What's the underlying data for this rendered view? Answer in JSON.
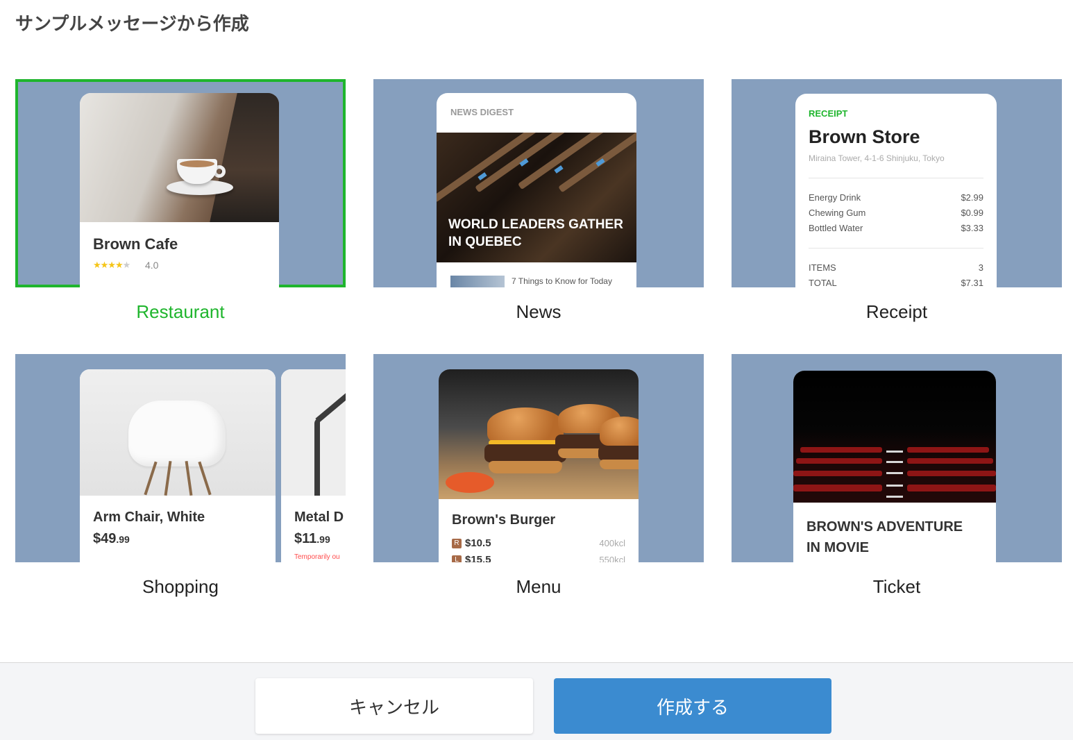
{
  "title": "サンプルメッセージから作成",
  "templates": {
    "restaurant": {
      "label": "Restaurant",
      "selected": true,
      "card": {
        "name": "Brown Cafe",
        "stars": 4,
        "rating": "4.0"
      }
    },
    "news": {
      "label": "News",
      "card": {
        "header": "NEWS DIGEST",
        "headline_line1": "WORLD LEADERS GATHER",
        "headline_line2": "IN QUEBEC",
        "item": "7 Things to Know for Today"
      }
    },
    "receipt": {
      "label": "Receipt",
      "card": {
        "tag": "RECEIPT",
        "store": "Brown Store",
        "address": "Miraina Tower, 4-1-6 Shinjuku, Tokyo",
        "items": [
          {
            "name": "Energy Drink",
            "price": "$2.99"
          },
          {
            "name": "Chewing Gum",
            "price": "$0.99"
          },
          {
            "name": "Bottled Water",
            "price": "$3.33"
          }
        ],
        "items_label": "ITEMS",
        "items_count": "3",
        "total_label": "TOTAL",
        "total": "$7.31"
      }
    },
    "shopping": {
      "label": "Shopping",
      "cards": [
        {
          "name": "Arm Chair, White",
          "price_main": "$49",
          "price_cents": ".99"
        },
        {
          "name": "Metal D",
          "price_main": "$11",
          "price_cents": ".99",
          "note": "Temporarily ou"
        }
      ]
    },
    "menu": {
      "label": "Menu",
      "card": {
        "name": "Brown's Burger",
        "rows": [
          {
            "badge": "R",
            "price": "$10.5",
            "kcal": "400kcl"
          },
          {
            "badge": "L",
            "price": "$15.5",
            "kcal": "550kcl"
          }
        ]
      }
    },
    "ticket": {
      "label": "Ticket",
      "card": {
        "title_line1": "BROWN'S ADVENTURE",
        "title_line2": "IN MOVIE"
      }
    }
  },
  "footer": {
    "cancel_label": "キャンセル",
    "create_label": "作成する"
  },
  "colors": {
    "selected": "#1fb52d",
    "tile_bg": "#869fbe",
    "primary_button": "#3b8bd0"
  }
}
